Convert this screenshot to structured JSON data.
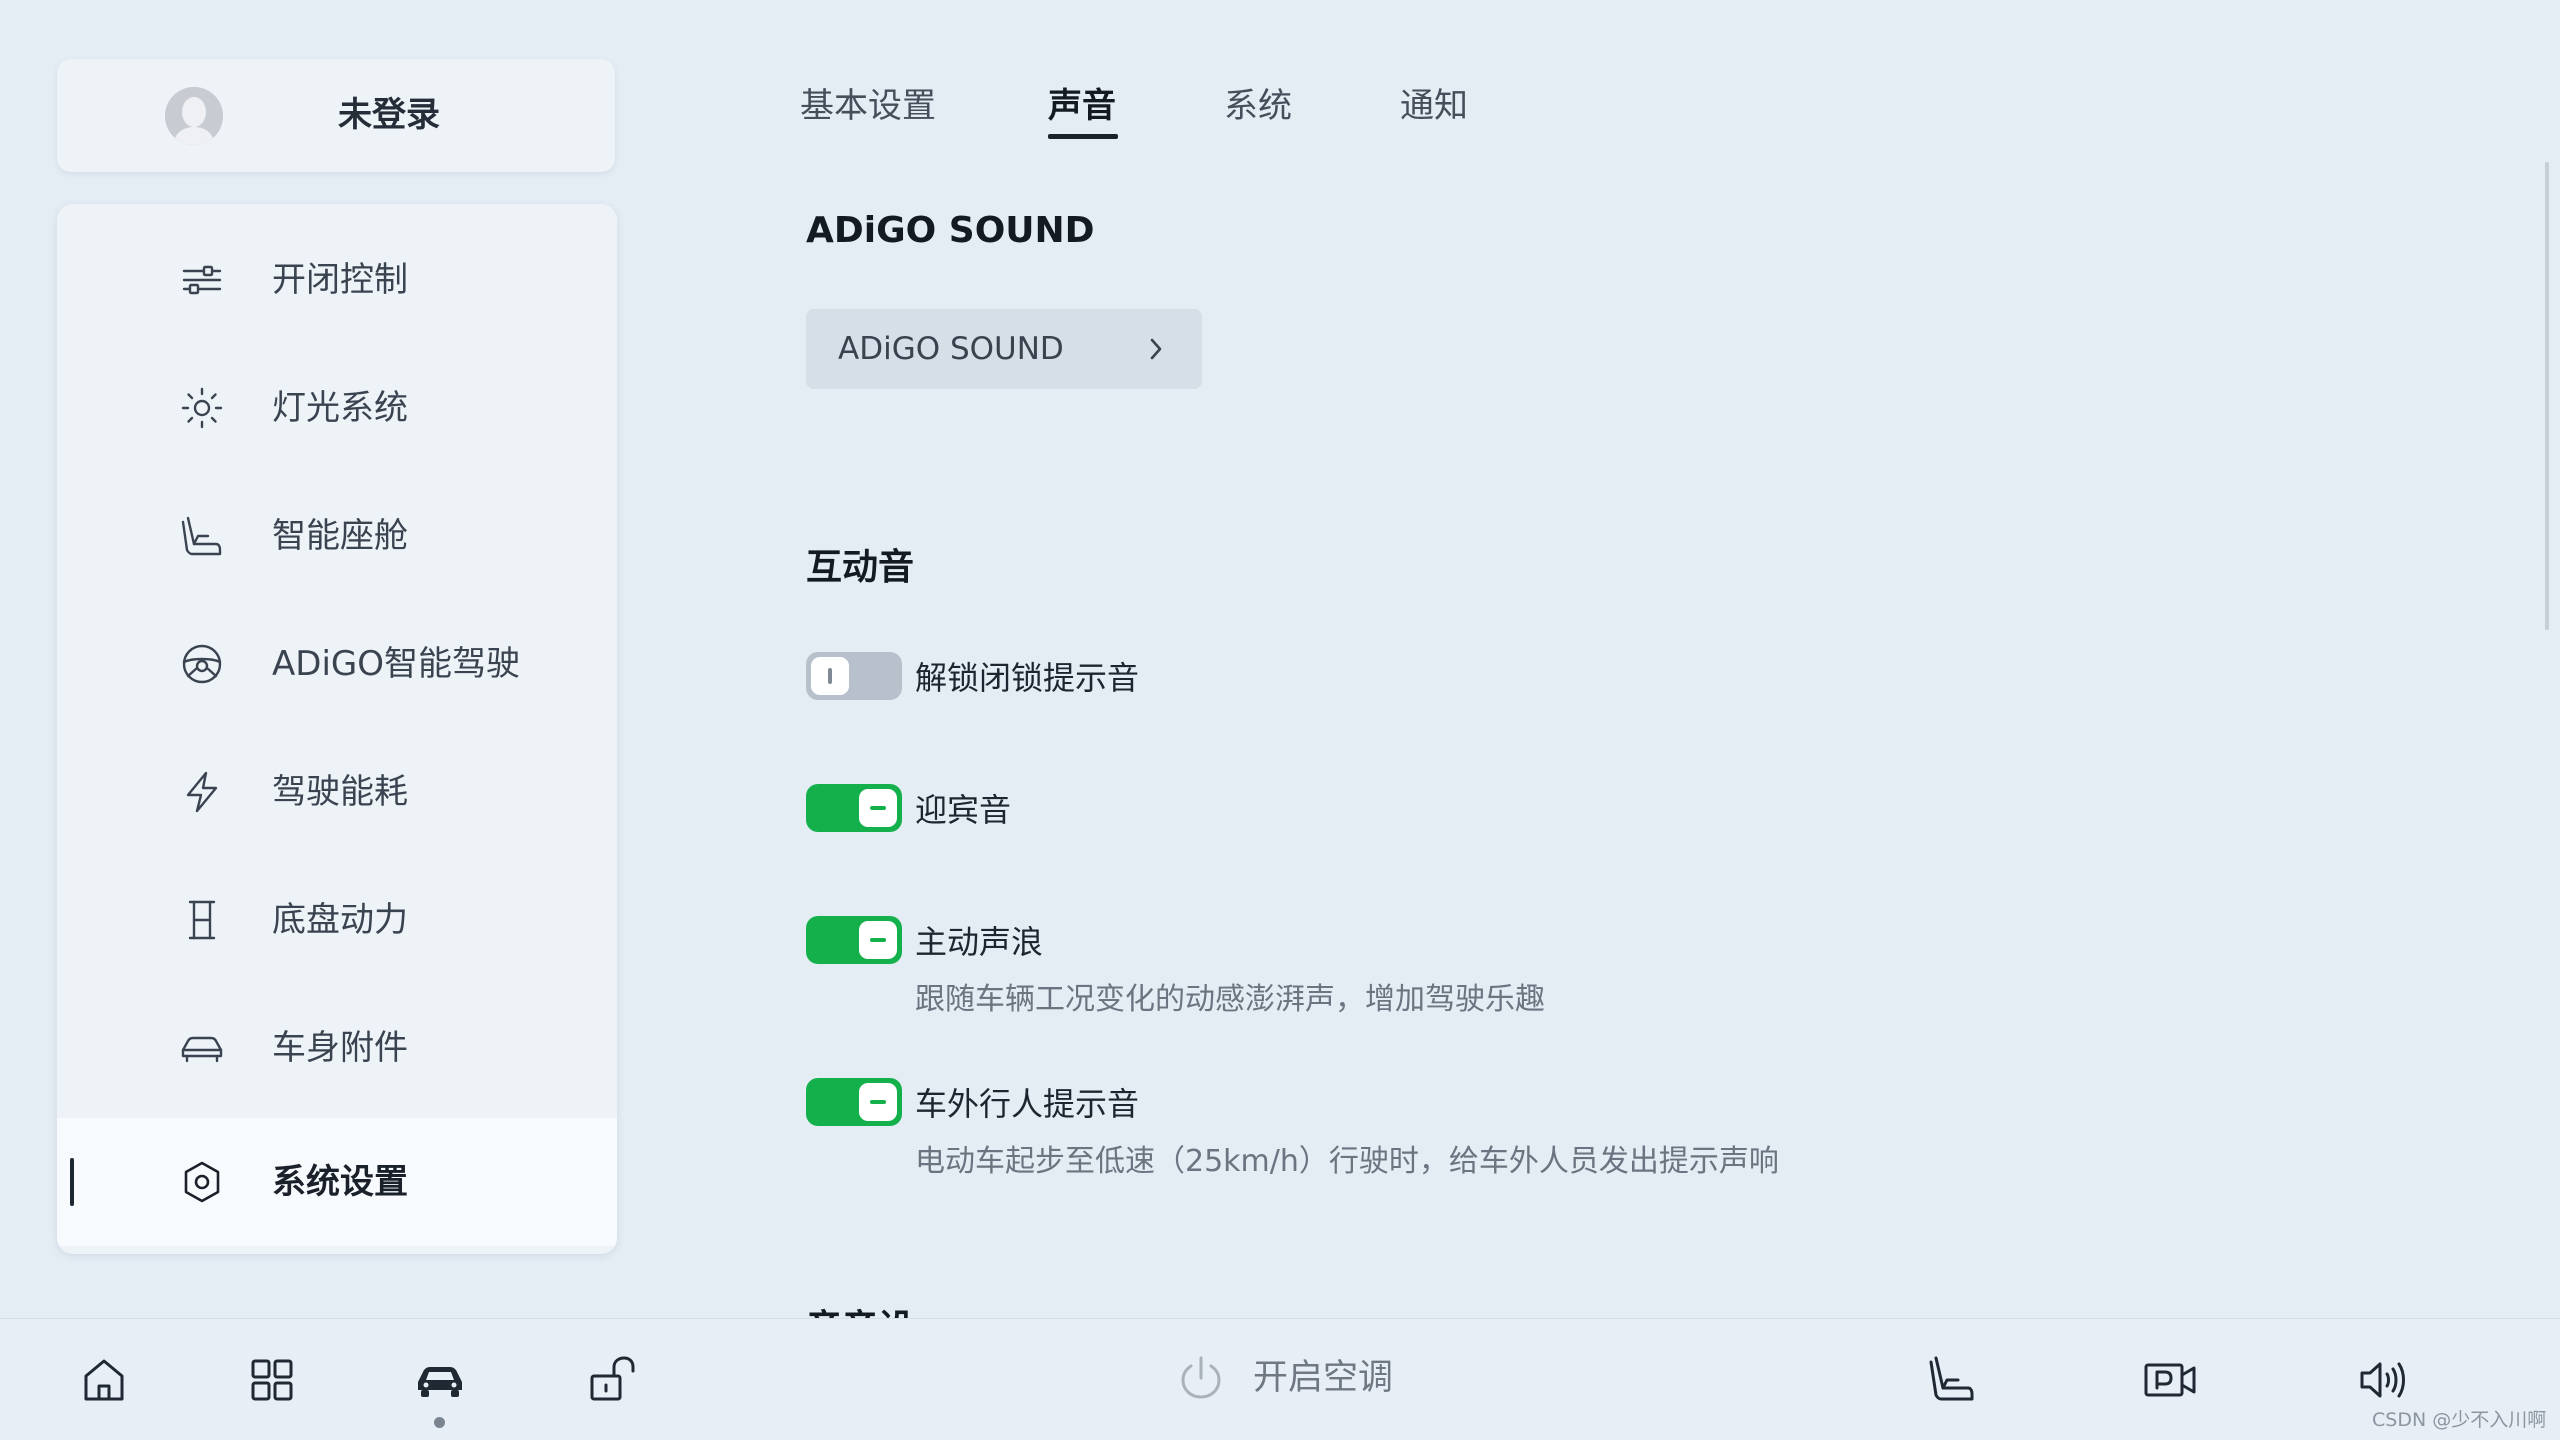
{
  "user": {
    "name": "未登录"
  },
  "sidebar": {
    "items": [
      {
        "label": "开闭控制",
        "icon": "sliders-icon"
      },
      {
        "label": "灯光系统",
        "icon": "sun-icon"
      },
      {
        "label": "智能座舱",
        "icon": "seat-icon"
      },
      {
        "label": "ADiGO智能驾驶",
        "icon": "steering-wheel-icon"
      },
      {
        "label": "驾驶能耗",
        "icon": "lightning-icon"
      },
      {
        "label": "底盘动力",
        "icon": "chassis-icon"
      },
      {
        "label": "车身附件",
        "icon": "car-body-icon"
      },
      {
        "label": "系统设置",
        "icon": "settings-hexagon-icon",
        "active": true
      }
    ]
  },
  "tabs": [
    {
      "label": "基本设置"
    },
    {
      "label": "声音",
      "active": true
    },
    {
      "label": "系统"
    },
    {
      "label": "通知"
    }
  ],
  "sections": {
    "adigo_title": "ADiGO SOUND",
    "adigo_button_label": "ADiGO SOUND",
    "interaction_title": "互动音",
    "next_title_partial": "音音设"
  },
  "switches": [
    {
      "label": "解锁闭锁提示音",
      "state": "off",
      "description": ""
    },
    {
      "label": "迎宾音",
      "state": "on",
      "description": ""
    },
    {
      "label": "主动声浪",
      "state": "on",
      "description": "跟随车辆工况变化的动感澎湃声，增加驾驶乐趣"
    },
    {
      "label": "车外行人提示音",
      "state": "on",
      "description": "电动车起步至低速（25km/h）行驶时，给车外人员发出提示声响"
    }
  ],
  "dock": {
    "items": [
      "home-icon",
      "apps-grid-icon",
      "car-icon",
      "unlock-icon",
      "power-icon",
      "seat-icon",
      "camera-p-icon",
      "volume-icon"
    ],
    "ac_label": "开启空调",
    "active_item": "car-icon"
  },
  "watermark": "CSDN @少不入川啊",
  "colors": {
    "background": "#e4ecf4",
    "card": "#eef3f8",
    "toggle_on": "#14b04c",
    "toggle_off": "#b8c1cb"
  }
}
